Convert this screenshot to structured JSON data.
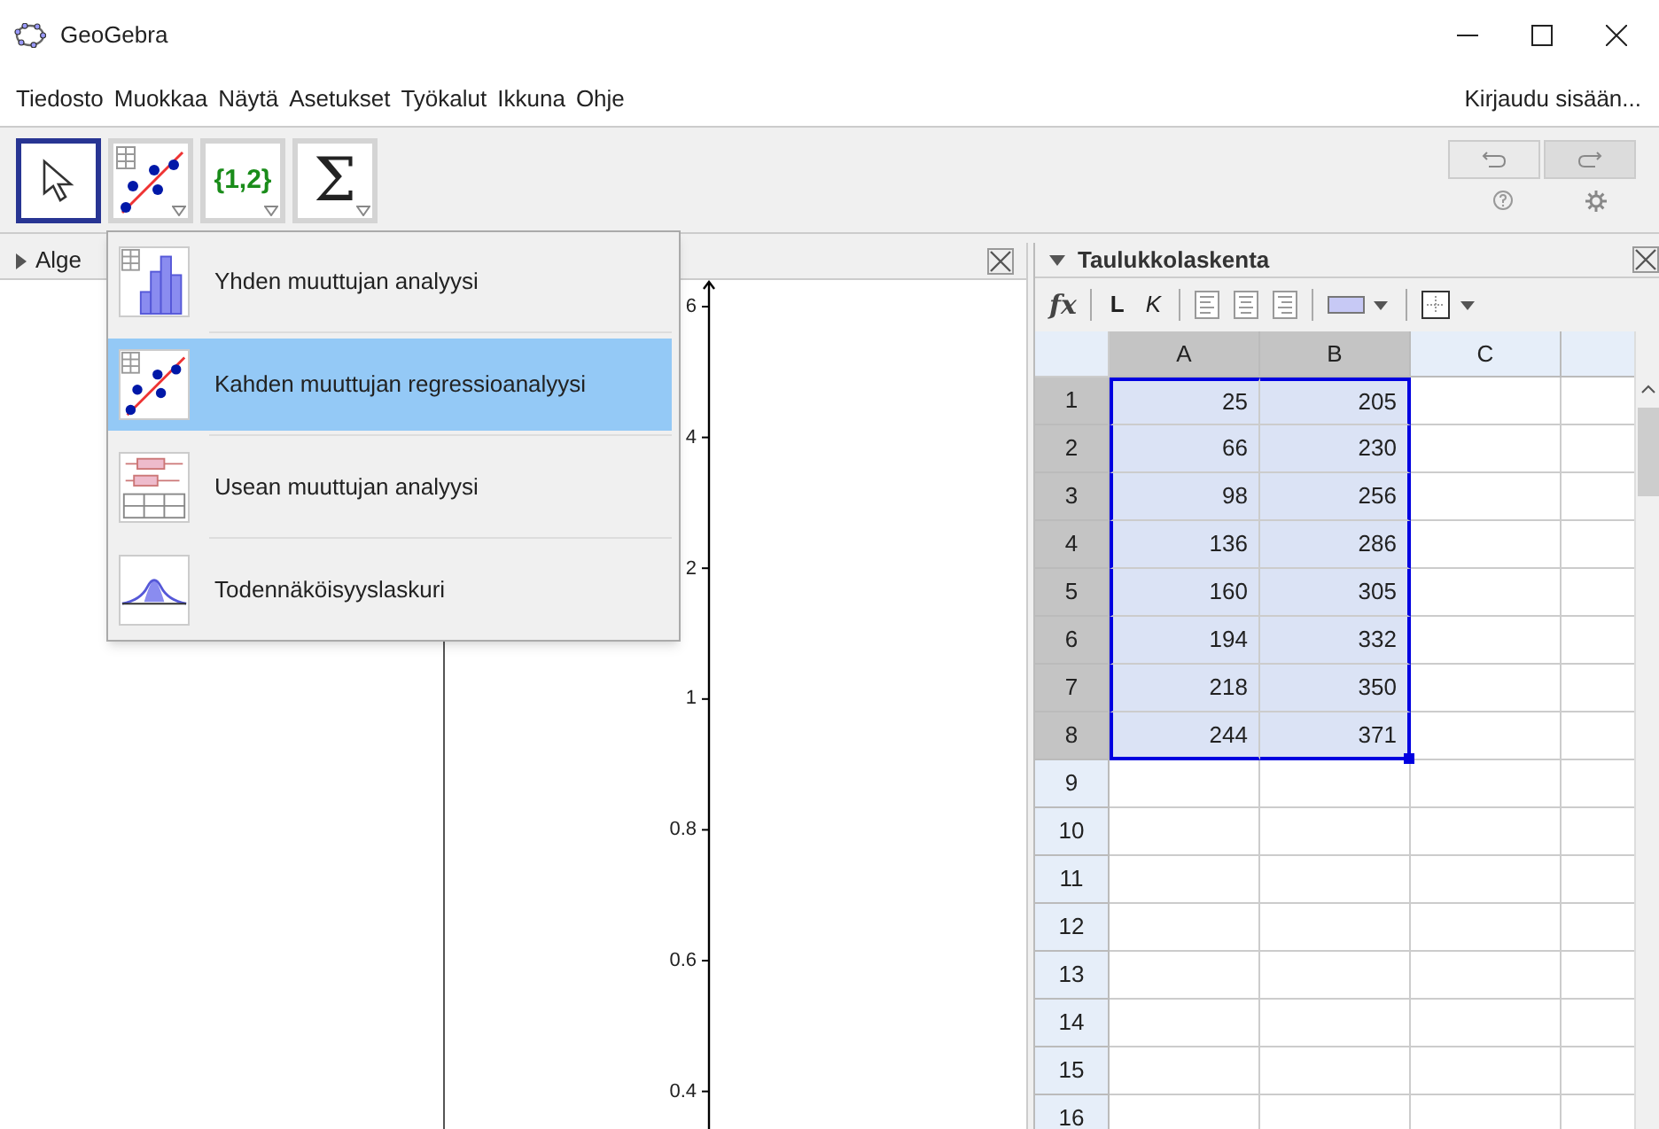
{
  "window": {
    "title": "GeoGebra"
  },
  "menu": [
    "Tiedosto",
    "Muokkaa",
    "Näytä",
    "Asetukset",
    "Työkalut",
    "Ikkuna",
    "Ohje"
  ],
  "login": "Kirjaudu sisään...",
  "toolbar": [
    {
      "kind": "move",
      "selected": true
    },
    {
      "kind": "scatter",
      "selected": false
    },
    {
      "kind": "list",
      "label": "{1,2}",
      "selected": false
    },
    {
      "kind": "sum",
      "label": "Σ",
      "selected": false
    }
  ],
  "algebra": {
    "title": "Alge"
  },
  "graphics": {
    "tick_labels": [
      "6",
      "4",
      "2",
      "1",
      "0.8",
      "0.6",
      "0.4"
    ]
  },
  "dropdown": [
    {
      "kind": "histogram",
      "label": "Yhden muuttujan analyysi",
      "selected": false
    },
    {
      "kind": "scatter",
      "label": "Kahden muuttujan regressioanalyysi",
      "selected": true
    },
    {
      "kind": "boxplot",
      "label": "Usean muuttujan analyysi",
      "selected": false
    },
    {
      "kind": "normal",
      "label": "Todennäköisyyslaskuri",
      "selected": false
    }
  ],
  "spreadsheet": {
    "title": "Taulukkolaskenta",
    "fx": "fx",
    "bold": "L",
    "italic": "K",
    "columns": [
      {
        "label": "A",
        "selected": true
      },
      {
        "label": "B",
        "selected": true
      },
      {
        "label": "C",
        "selected": false
      }
    ],
    "rows": [
      {
        "label": "1",
        "selected": true,
        "cells": [
          "25",
          "205"
        ]
      },
      {
        "label": "2",
        "selected": true,
        "cells": [
          "66",
          "230"
        ]
      },
      {
        "label": "3",
        "selected": true,
        "cells": [
          "98",
          "256"
        ]
      },
      {
        "label": "4",
        "selected": true,
        "cells": [
          "136",
          "286"
        ]
      },
      {
        "label": "5",
        "selected": true,
        "cells": [
          "160",
          "305"
        ]
      },
      {
        "label": "6",
        "selected": true,
        "cells": [
          "194",
          "332"
        ]
      },
      {
        "label": "7",
        "selected": true,
        "cells": [
          "218",
          "350"
        ]
      },
      {
        "label": "8",
        "selected": true,
        "cells": [
          "244",
          "371"
        ]
      },
      {
        "label": "9",
        "selected": false,
        "cells": []
      },
      {
        "label": "10",
        "selected": false,
        "cells": []
      },
      {
        "label": "11",
        "selected": false,
        "cells": []
      },
      {
        "label": "12",
        "selected": false,
        "cells": []
      },
      {
        "label": "13",
        "selected": false,
        "cells": []
      },
      {
        "label": "14",
        "selected": false,
        "cells": []
      },
      {
        "label": "15",
        "selected": false,
        "cells": []
      },
      {
        "label": "16",
        "selected": false,
        "cells": []
      }
    ]
  }
}
